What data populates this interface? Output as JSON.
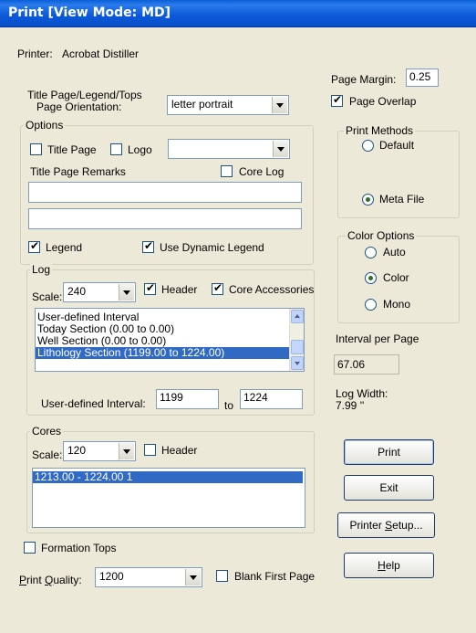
{
  "window": {
    "title": "Print [View Mode: MD]"
  },
  "printer": {
    "label": "Printer:",
    "name": "Acrobat Distiller"
  },
  "page_margin": {
    "label": "Page Margin:",
    "value": "0.25"
  },
  "page_overlap": {
    "label": "Page Overlap",
    "checked": true
  },
  "orientation": {
    "label_line1": "Title Page/Legend/Tops",
    "label_line2": "Page Orientation:",
    "value": "letter portrait"
  },
  "options": {
    "legend": "Options",
    "title_page": {
      "label": "Title Page",
      "checked": false
    },
    "logo": {
      "label": "Logo",
      "checked": false,
      "value": ""
    },
    "remarks_label": "Title Page Remarks",
    "core_log": {
      "label": "Core Log",
      "checked": false
    },
    "remark1": "",
    "remark2": "",
    "legend_chk": {
      "label": "Legend",
      "checked": true
    },
    "dynamic_legend": {
      "label": "Use Dynamic Legend",
      "checked": true
    }
  },
  "log": {
    "legend": "Log",
    "scale_label": "Scale:",
    "scale_value": "240",
    "header": {
      "label": "Header",
      "checked": true
    },
    "core_accessories": {
      "label": "Core Accessories",
      "checked": true
    },
    "items": [
      "User-defined Interval",
      "Today Section (0.00 to 0.00)",
      "Well Section (0.00 to 0.00)",
      "Lithology Section (1199.00 to 1224.00)"
    ],
    "selected_index": 3,
    "interval_label": "User-defined Interval:",
    "interval_from": "1199",
    "to_label": "to",
    "interval_to": "1224"
  },
  "cores": {
    "legend": "Cores",
    "scale_label": "Scale:",
    "scale_value": "120",
    "header": {
      "label": "Header",
      "checked": false
    },
    "items": [
      "1213.00 - 1224.00  1"
    ],
    "selected_index": 0
  },
  "formation_tops": {
    "label": "Formation Tops",
    "checked": false
  },
  "print_quality": {
    "label": "Print Quality:",
    "value": "1200"
  },
  "blank_first_page": {
    "label": "Blank First Page",
    "checked": false
  },
  "print_methods": {
    "legend": "Print Methods",
    "default": {
      "label": "Default",
      "selected": false
    },
    "meta_file": {
      "label": "Meta File",
      "selected": true
    }
  },
  "color_options": {
    "legend": "Color Options",
    "auto": {
      "label": "Auto",
      "selected": false
    },
    "color": {
      "label": "Color",
      "selected": true
    },
    "mono": {
      "label": "Mono",
      "selected": false
    }
  },
  "interval_per_page": {
    "label": "Interval per Page",
    "value": "67.06"
  },
  "log_width": {
    "label": "Log Width:",
    "value": "7.99 ''"
  },
  "buttons": {
    "print": "Print",
    "exit": "Exit",
    "printer_setup": "Printer Setup...",
    "help": "Help"
  }
}
